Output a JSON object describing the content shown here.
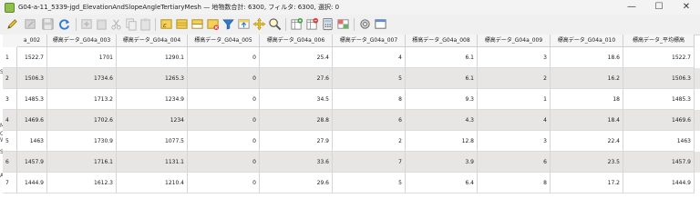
{
  "window": {
    "title": "G04-a-11_5339-jgd_ElevationAndSlopeAngleTertiaryMesh — 地物数合計: 6300, フィルタ: 6300, 選択: 0",
    "minimize_glyph": "—",
    "maximize_glyph": "☐",
    "close_glyph": "✕"
  },
  "toolbar": {
    "buttons": [
      {
        "name": "toggle-editing-icon"
      },
      {
        "name": "toggle-multi-edit-icon"
      },
      {
        "name": "save-edits-icon"
      },
      {
        "name": "reload-table-icon"
      },
      {
        "name": "add-feature-icon"
      },
      {
        "name": "delete-selected-icon"
      },
      {
        "name": "cut-icon"
      },
      {
        "name": "copy-icon"
      },
      {
        "name": "paste-icon"
      },
      {
        "name": "select-by-expression-icon"
      },
      {
        "name": "select-all-icon"
      },
      {
        "name": "invert-selection-icon"
      },
      {
        "name": "deselect-all-icon"
      },
      {
        "name": "filter-select-icon"
      },
      {
        "name": "move-selection-top-icon"
      },
      {
        "name": "pan-to-selected-icon"
      },
      {
        "name": "zoom-to-selected-icon"
      },
      {
        "name": "new-field-icon"
      },
      {
        "name": "delete-field-icon"
      },
      {
        "name": "field-calculator-icon"
      },
      {
        "name": "conditional-formatting-icon"
      },
      {
        "name": "actions-icon"
      },
      {
        "name": "dock-table-icon"
      }
    ]
  },
  "left_strip_labels": [
    "S",
    "M",
    "C",
    "W",
    "S",
    "A"
  ],
  "table": {
    "columns": [
      "a_002",
      "標高データ_G04a_003",
      "標高データ_G04a_004",
      "標高データ_G04a_005",
      "標高データ_G04a_006",
      "標高データ_G04a_007",
      "標高データ_G04a_008",
      "標高データ_G04a_009",
      "標高データ_G04a_010",
      "標高データ_平均標高"
    ],
    "rows": [
      {
        "num": "1",
        "cells": [
          "1522.7",
          "1701",
          "1290.1",
          "0",
          "25.4",
          "4",
          "6.1",
          "3",
          "18.6",
          "1522.7"
        ]
      },
      {
        "num": "2",
        "cells": [
          "1506.3",
          "1734.6",
          "1265.3",
          "0",
          "27.6",
          "5",
          "6.1",
          "2",
          "16.2",
          "1506.3"
        ]
      },
      {
        "num": "3",
        "cells": [
          "1485.3",
          "1713.2",
          "1234.9",
          "0",
          "34.5",
          "8",
          "9.3",
          "1",
          "18",
          "1485.3"
        ]
      },
      {
        "num": "4",
        "cells": [
          "1469.6",
          "1702.6",
          "1234",
          "0",
          "28.8",
          "6",
          "4.3",
          "4",
          "18.4",
          "1469.6"
        ]
      },
      {
        "num": "5",
        "cells": [
          "1463",
          "1730.9",
          "1077.5",
          "0",
          "27.9",
          "2",
          "12.8",
          "3",
          "22.4",
          "1463"
        ]
      },
      {
        "num": "6",
        "cells": [
          "1457.9",
          "1716.1",
          "1131.1",
          "0",
          "33.6",
          "7",
          "3.9",
          "6",
          "23.5",
          "1457.9"
        ]
      },
      {
        "num": "7",
        "cells": [
          "1444.9",
          "1612.3",
          "1210.4",
          "0",
          "29.6",
          "5",
          "6.4",
          "8",
          "17.2",
          "1444.9"
        ]
      }
    ]
  }
}
